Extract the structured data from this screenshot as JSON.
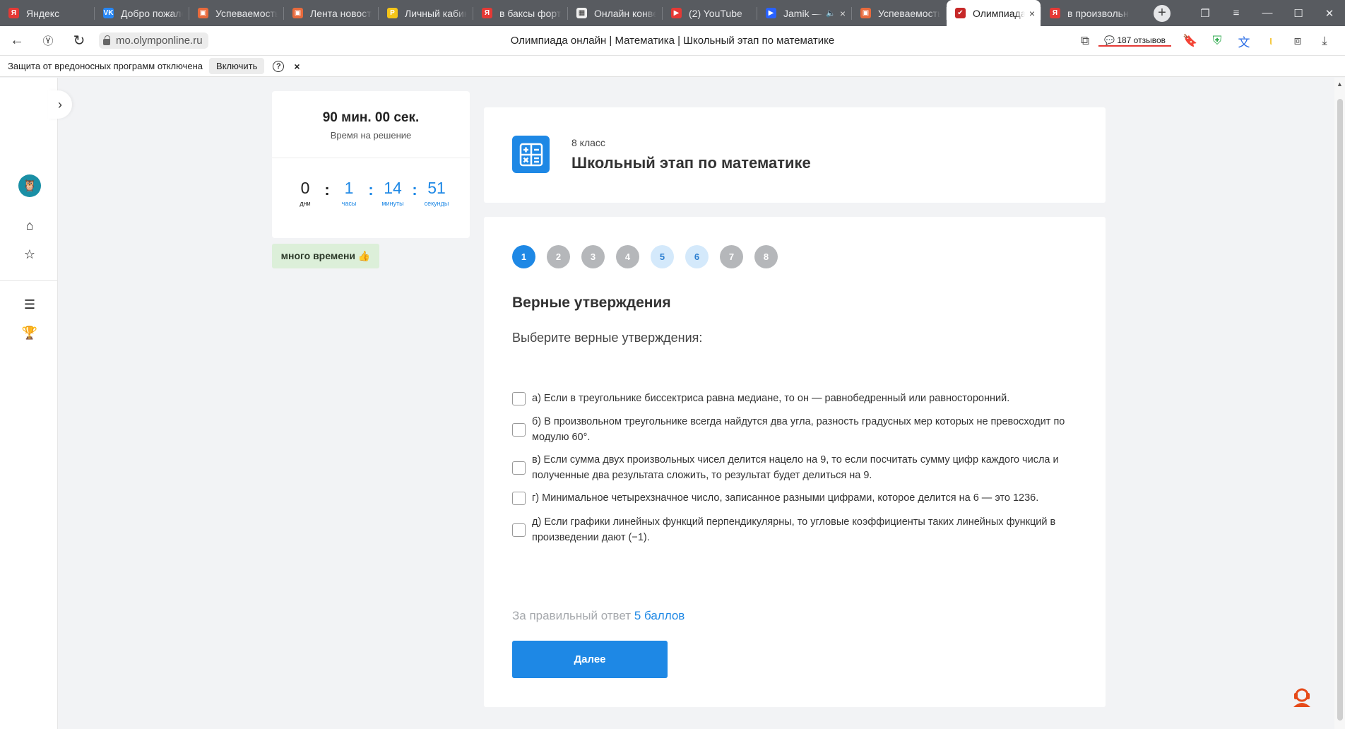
{
  "browser": {
    "tabs": [
      {
        "label": "Яндекс",
        "fav_color": "#e53935",
        "fav_letter": "Я"
      },
      {
        "label": "Добро пожаловать",
        "fav_color": "#2787f5",
        "fav_letter": "VK"
      },
      {
        "label": "Успеваемость",
        "fav_color": "#e86a3c",
        "fav_letter": "▣"
      },
      {
        "label": "Лента новостей",
        "fav_color": "#e86a3c",
        "fav_letter": "▣"
      },
      {
        "label": "Личный кабинет",
        "fav_color": "#f5c518",
        "fav_letter": "Р"
      },
      {
        "label": "в баксы фортнайт",
        "fav_color": "#e53935",
        "fav_letter": "Я"
      },
      {
        "label": "Онлайн конвертер",
        "fav_color": "#f0f0f0",
        "fav_letter": "▦"
      },
      {
        "label": "(2) YouTube",
        "fav_color": "#e53935",
        "fav_letter": "▶"
      },
      {
        "label": "Jamik — ",
        "fav_color": "#2962ff",
        "fav_letter": "▶",
        "muted_icon": "🔈",
        "close": "×"
      },
      {
        "label": "Успеваемость",
        "fav_color": "#e86a3c",
        "fav_letter": "▣"
      },
      {
        "label": "Олимпиада",
        "fav_color": "#c62828",
        "fav_letter": "✔",
        "active": true,
        "close": "×"
      },
      {
        "label": "в произвольном",
        "fav_color": "#e53935",
        "fav_letter": "Я"
      }
    ],
    "url": "mo.olymponline.ru",
    "page_title": "Олимпиада онлайн | Математика | Школьный этап по математике",
    "reviews": "187 отзывов"
  },
  "infobar": {
    "message": "Защита от вредоносных программ отключена",
    "enable_label": "Включить",
    "help_label": "?",
    "close_label": "×"
  },
  "timer": {
    "total": "90 мин. 00 сек.",
    "total_caption": "Время на решение",
    "days": "0",
    "days_label": "дни",
    "hours": "1",
    "hours_label": "часы",
    "minutes": "14",
    "minutes_label": "минуты",
    "seconds": "51",
    "seconds_label": "секунды",
    "badge": "много времени 👍"
  },
  "header": {
    "grade": "8 класс",
    "stage": "Школьный этап по математике"
  },
  "question": {
    "numbers": [
      {
        "n": "1",
        "state": "active"
      },
      {
        "n": "2",
        "state": "grey"
      },
      {
        "n": "3",
        "state": "grey"
      },
      {
        "n": "4",
        "state": "grey"
      },
      {
        "n": "5",
        "state": "light"
      },
      {
        "n": "6",
        "state": "light"
      },
      {
        "n": "7",
        "state": "grey"
      },
      {
        "n": "8",
        "state": "grey"
      }
    ],
    "title": "Верные утверждения",
    "prompt": "Выберите верные утверждения:",
    "options": [
      "а) Если в треугольнике биссектриса равна медиане, то он — равнобедренный или равносторонний.",
      "б) В произвольном треугольнике всегда найдутся два угла, разность градусных мер которых не превосходит по модулю 60°.",
      "в) Если сумма двух произвольных чисел делится нацело на 9, то если посчитать сумму цифр каждого числа и полученные два результата сложить, то результат будет делиться на 9.",
      "г) Минимальное четырехзначное число, записанное разными цифрами, которое делится на 6 — это 1236.",
      "д) Если графики линейных функций перпендикулярны, то угловые коэффициенты таких линейных функций в произведении дают (−1)."
    ],
    "score_prefix": "За правильный ответ",
    "score_value": "5 баллов",
    "next_label": "Далее"
  },
  "colors": {
    "accent": "#1e88e5",
    "badge_bg": "#dcefd9",
    "tabbar": "#585b60"
  }
}
